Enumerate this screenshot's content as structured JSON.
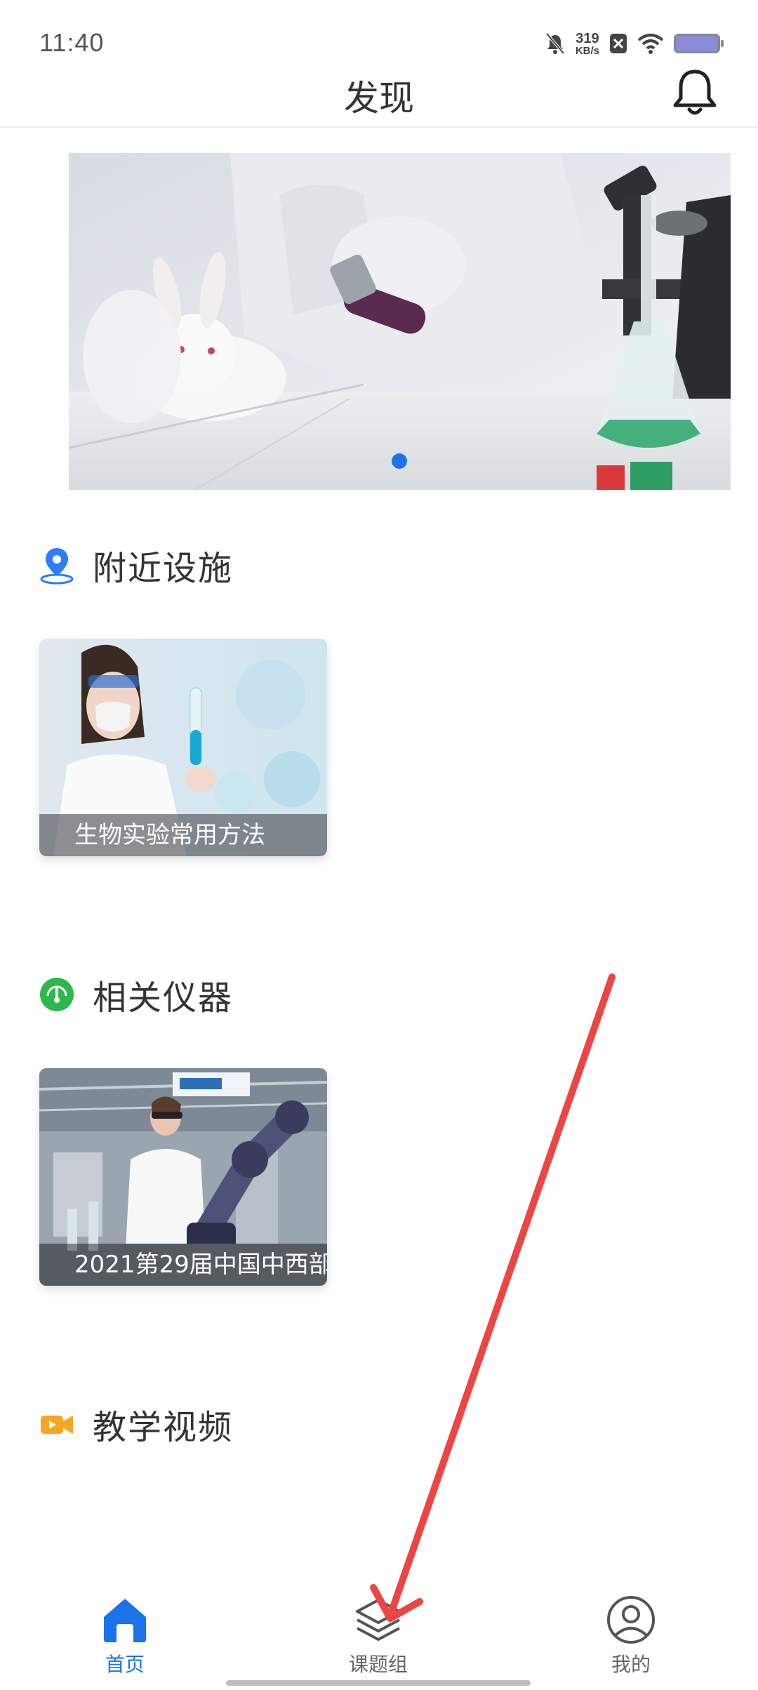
{
  "status_bar": {
    "time": "11:40",
    "net_speed_value": "319",
    "net_speed_unit": "KB/s"
  },
  "header": {
    "title": "发现"
  },
  "banner": {
    "slide_count": 1,
    "active_slide": 1
  },
  "sections": {
    "nearby": {
      "title": "附近设施",
      "icon": "location-pin-icon",
      "icon_color": "#2f7cf6",
      "card_caption": "生物实验常用方法"
    },
    "instruments": {
      "title": "相关仪器",
      "icon": "gauge-icon",
      "icon_color": "#2db84d",
      "card_caption": "2021第29届中国中西部"
    },
    "videos": {
      "title": "教学视频",
      "icon": "video-camera-icon",
      "icon_color": "#f5a623"
    }
  },
  "bottom_nav": {
    "items": [
      {
        "label": "首页",
        "icon": "home-icon",
        "active": true
      },
      {
        "label": "课题组",
        "icon": "layers-icon",
        "active": false
      },
      {
        "label": "我的",
        "icon": "user-circle-icon",
        "active": false
      }
    ]
  },
  "colors": {
    "accent": "#1a73e8",
    "annotation_arrow": "#ef4444"
  }
}
